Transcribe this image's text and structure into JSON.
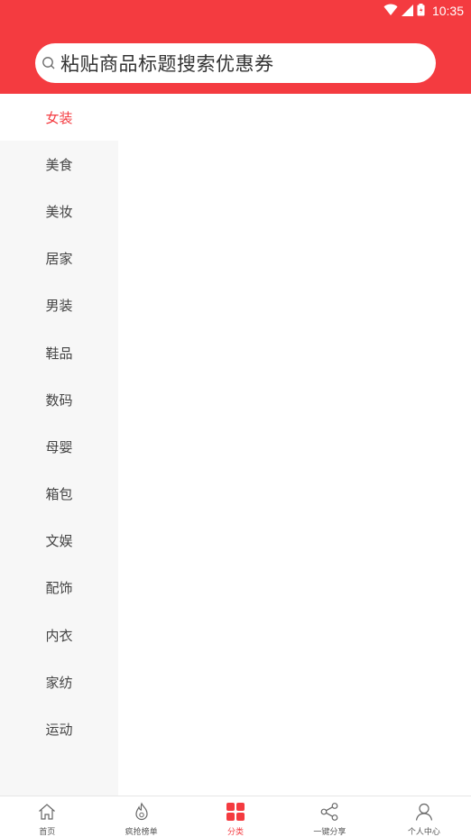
{
  "status_bar": {
    "time": "10:35",
    "icons": [
      "wifi-icon",
      "signal-icon",
      "battery-icon"
    ]
  },
  "search": {
    "text": "粘贴商品标题搜索优惠券",
    "icon": "search-icon"
  },
  "sidebar": {
    "items": [
      {
        "label": "女装",
        "active": true
      },
      {
        "label": "美食"
      },
      {
        "label": "美妆"
      },
      {
        "label": "居家"
      },
      {
        "label": "男装"
      },
      {
        "label": "鞋品"
      },
      {
        "label": "数码"
      },
      {
        "label": "母婴"
      },
      {
        "label": "箱包"
      },
      {
        "label": "文娱"
      },
      {
        "label": "配饰"
      },
      {
        "label": "内衣"
      },
      {
        "label": "家纺"
      },
      {
        "label": "运动"
      }
    ]
  },
  "tabbar": {
    "items": [
      {
        "label": "首页",
        "icon": "home-icon"
      },
      {
        "label": "疯抢榜单",
        "icon": "flame-icon"
      },
      {
        "label": "分类",
        "icon": "grid-icon",
        "active": true
      },
      {
        "label": "一键分享",
        "icon": "share-icon"
      },
      {
        "label": "个人中心",
        "icon": "user-icon"
      }
    ]
  },
  "colors": {
    "accent": "#f43b40",
    "sidebar_bg": "#f7f7f7",
    "text": "#444444"
  }
}
